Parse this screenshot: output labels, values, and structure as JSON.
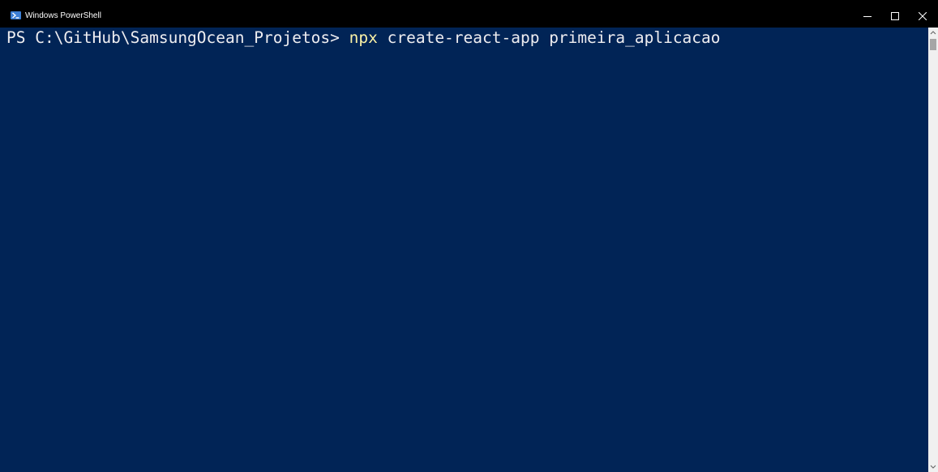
{
  "window": {
    "title": "Windows PowerShell",
    "controls": {
      "minimize_icon": "minimize-icon",
      "maximize_icon": "maximize-icon",
      "close_icon": "close-icon"
    }
  },
  "terminal": {
    "prompt": "PS C:\\GitHub\\SamsungOcean_Projetos> ",
    "command": "npx",
    "arguments": " create-react-app primeira_aplicacao"
  },
  "colors": {
    "background": "#012456",
    "text": "#eeedf0",
    "command": "#f9f1a5",
    "titlebar": "#000000"
  }
}
